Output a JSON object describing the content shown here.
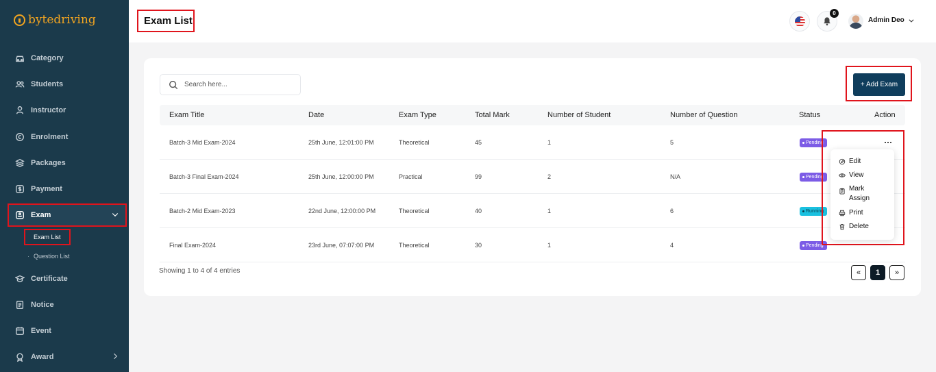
{
  "brand": {
    "name": "bytedriving",
    "accent": "#f3a520"
  },
  "sidebar": {
    "items": [
      {
        "label": "Category",
        "icon": "car-icon"
      },
      {
        "label": "Students",
        "icon": "users-icon"
      },
      {
        "label": "Instructor",
        "icon": "user-icon"
      },
      {
        "label": "Enrolment",
        "icon": "copyright-icon"
      },
      {
        "label": "Packages",
        "icon": "layers-icon"
      },
      {
        "label": "Payment",
        "icon": "dollar-icon"
      },
      {
        "label": "Exam",
        "icon": "exam-icon"
      },
      {
        "label": "Certificate",
        "icon": "graduation-cap-icon"
      },
      {
        "label": "Notice",
        "icon": "notice-icon"
      },
      {
        "label": "Event",
        "icon": "calendar-icon"
      },
      {
        "label": "Award",
        "icon": "award-icon"
      }
    ],
    "exam_sub": [
      {
        "label": "Exam List"
      },
      {
        "label": "Question List"
      }
    ]
  },
  "header": {
    "title": "Exam List",
    "notification_count": "0",
    "user_name": "Admin Deo"
  },
  "toolbar": {
    "search_placeholder": "Search here...",
    "add_button": "+ Add Exam"
  },
  "table": {
    "columns": [
      "Exam Title",
      "Date",
      "Exam Type",
      "Total Mark",
      "Number of Student",
      "Number of Question",
      "Status",
      "Action"
    ],
    "rows": [
      {
        "title": "Batch-3 Mid Exam-2024",
        "date": "25th June, 12:01:00 PM",
        "type": "Theoretical",
        "total_mark": "45",
        "students": "1",
        "questions": "5",
        "status": "Pending"
      },
      {
        "title": "Batch-3 Final Exam-2024",
        "date": "25th June, 12:00:00 PM",
        "type": "Practical",
        "total_mark": "99",
        "students": "2",
        "questions": "N/A",
        "status": "Pending"
      },
      {
        "title": "Batch-2 Mid Exam-2023",
        "date": "22nd June, 12:00:00 PM",
        "type": "Theoretical",
        "total_mark": "40",
        "students": "1",
        "questions": "6",
        "status": "Running"
      },
      {
        "title": "Final Exam-2024",
        "date": "23rd June, 07:07:00 PM",
        "type": "Theoretical",
        "total_mark": "30",
        "students": "1",
        "questions": "4",
        "status": "Pending"
      }
    ]
  },
  "action_menu": {
    "items": [
      {
        "label": "Edit",
        "icon": "edit-icon"
      },
      {
        "label": "View",
        "icon": "eye-icon"
      },
      {
        "label": "Mark Assign",
        "icon": "clipboard-icon"
      },
      {
        "label": "Print",
        "icon": "printer-icon"
      },
      {
        "label": "Delete",
        "icon": "trash-icon"
      }
    ]
  },
  "pagination": {
    "info": "Showing 1 to 4 of 4 entries",
    "prev": "«",
    "current": "1",
    "next": "»"
  },
  "colors": {
    "sidebar_bg": "#1b3a4b",
    "primary_button": "#0f3d5c",
    "pending": "#7c5ce6",
    "running": "#1ac1e0",
    "highlight": "#e0141c"
  }
}
